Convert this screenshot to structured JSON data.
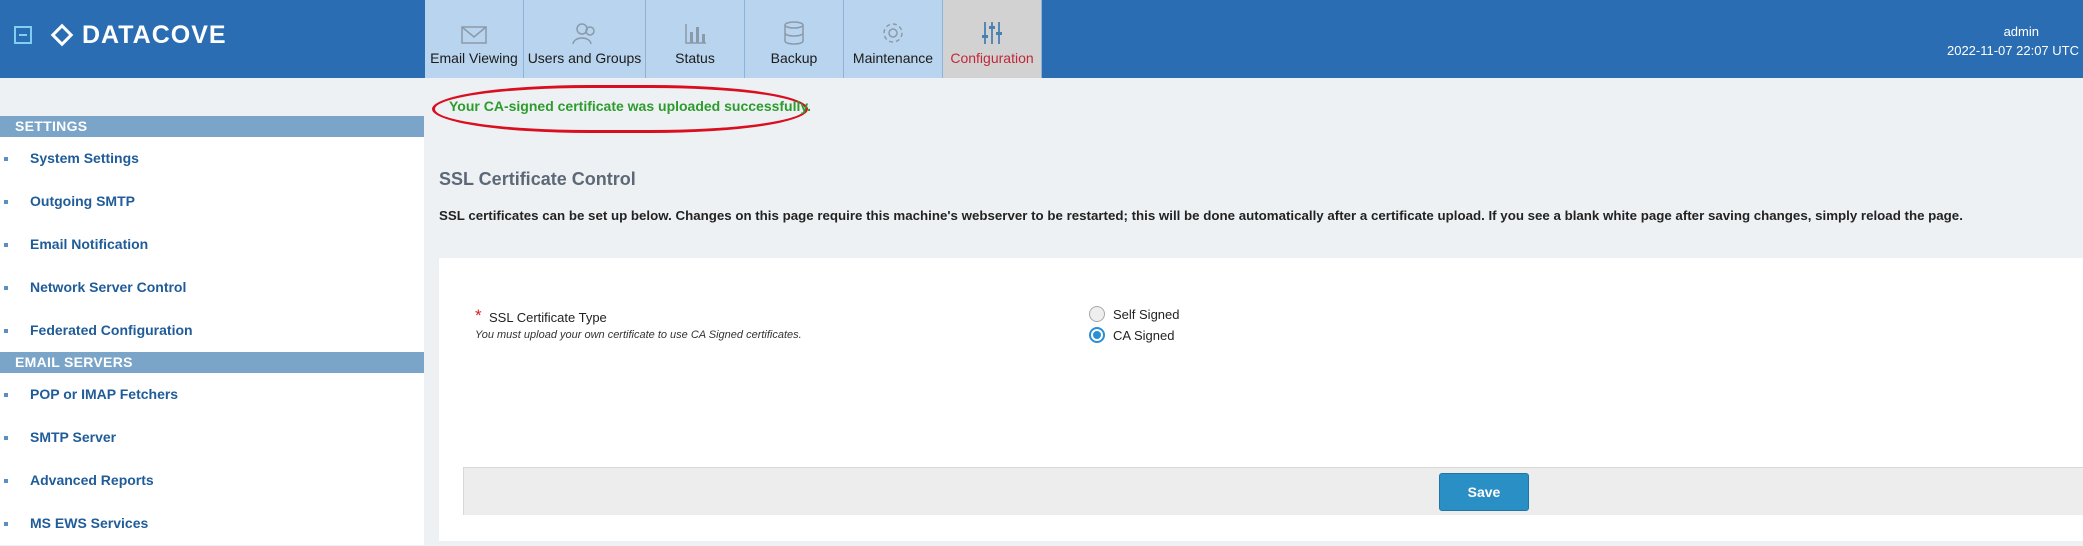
{
  "app": {
    "brand": "DATACOVE"
  },
  "nav": {
    "tabs": [
      {
        "label": "Email Viewing",
        "icon": "envelope-icon"
      },
      {
        "label": "Users and Groups",
        "icon": "users-icon"
      },
      {
        "label": "Status",
        "icon": "bar-chart-icon"
      },
      {
        "label": "Backup",
        "icon": "database-icon"
      },
      {
        "label": "Maintenance",
        "icon": "gear-icon"
      },
      {
        "label": "Configuration",
        "icon": "sliders-icon",
        "active": true
      }
    ]
  },
  "user": {
    "name": "admin",
    "datetime": "2022-11-07 22:07 UTC"
  },
  "sidebar": {
    "sections": [
      {
        "title": "SETTINGS",
        "items": [
          "System Settings",
          "Outgoing SMTP",
          "Email Notification",
          "Network Server Control",
          "Federated Configuration"
        ]
      },
      {
        "title": "EMAIL SERVERS",
        "items": [
          "POP or IMAP Fetchers",
          "SMTP Server",
          "Advanced Reports",
          "MS EWS Services"
        ]
      }
    ]
  },
  "main": {
    "banner": "Your CA-signed certificate was uploaded successfully.",
    "title": "SSL Certificate Control",
    "description": "SSL certificates can be set up below. Changes on this page require this machine's webserver to be restarted; this will be done automatically after a certificate upload. If you see a blank white page after saving changes, simply reload the page.",
    "field": {
      "required_mark": "*",
      "label": "SSL Certificate Type",
      "help": "You must upload your own certificate to use CA Signed certificates.",
      "options": [
        "Self Signed",
        "CA Signed"
      ],
      "selected": "CA Signed"
    },
    "save_label": "Save"
  },
  "colors": {
    "header": "#2a6db3",
    "active_tab_text": "#c0283a",
    "success": "#2c9c2c",
    "annotation": "#d90f1f",
    "button": "#2a8fc4"
  }
}
